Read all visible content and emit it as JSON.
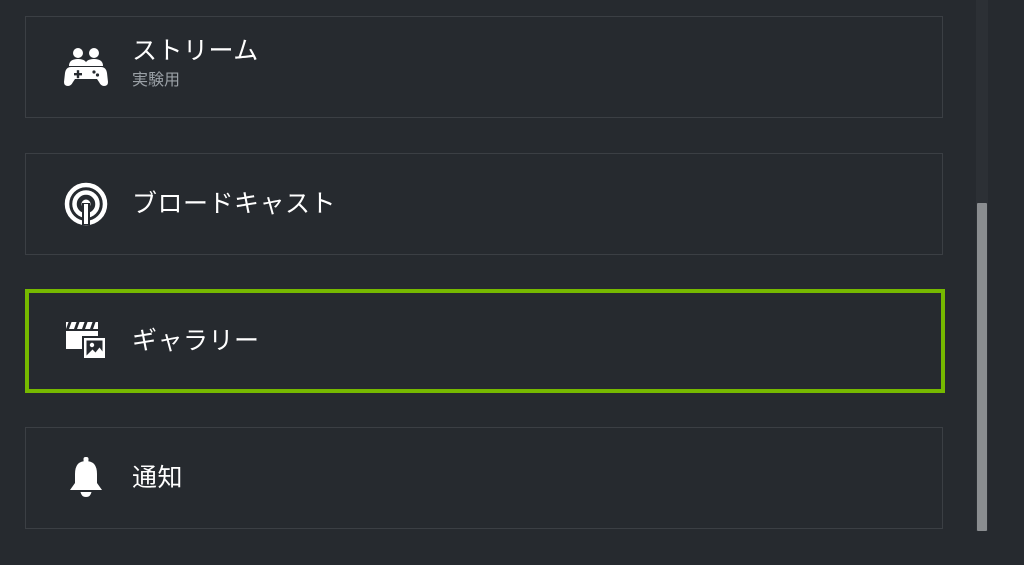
{
  "menu": {
    "items": [
      {
        "label": "ストリーム",
        "sublabel": "実験用",
        "icon": "stream-gamepad-icon",
        "selected": false
      },
      {
        "label": "ブロードキャスト",
        "sublabel": "",
        "icon": "broadcast-icon",
        "selected": false
      },
      {
        "label": "ギャラリー",
        "sublabel": "",
        "icon": "gallery-icon",
        "selected": true
      },
      {
        "label": "通知",
        "sublabel": "",
        "icon": "bell-icon",
        "selected": false
      }
    ]
  },
  "colors": {
    "background": "#262a2f",
    "item_border": "#3b3f44",
    "selected_border": "#76b900",
    "text": "#ffffff",
    "subtext": "#9aa0a6",
    "scroll_thumb": "#8a8d90"
  }
}
